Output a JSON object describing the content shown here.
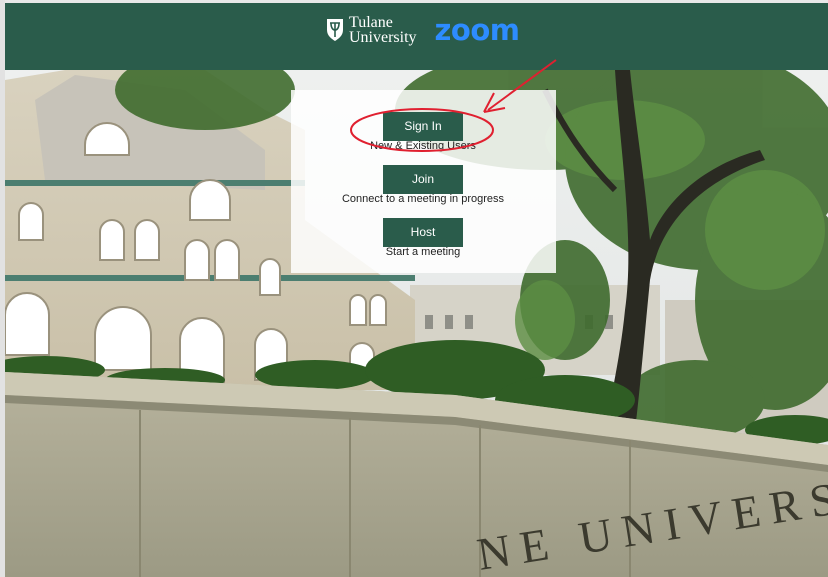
{
  "header": {
    "university_name_line1": "Tulane",
    "university_name_line2": "University",
    "zoom_wordmark": "zoom",
    "background_color": "#2a5c4b",
    "zoom_color": "#2d8cff"
  },
  "actions": [
    {
      "label": "Sign In",
      "caption": "New & Existing Users"
    },
    {
      "label": "Join",
      "caption": "Connect to a meeting in progress"
    },
    {
      "label": "Host",
      "caption": "Start a meeting"
    }
  ],
  "background_engraving": "NE UNIVERS",
  "annotation": {
    "color": "#e02030",
    "shapes": [
      "ellipse-around-sign-in",
      "arrow"
    ]
  }
}
